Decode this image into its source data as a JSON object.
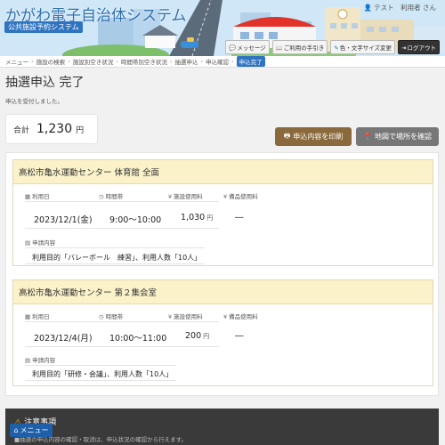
{
  "header": {
    "app_title": "かがわ電子自治体システム",
    "app_subtitle": "公共施設予約システム",
    "user_name": "テスト　利用者 さん",
    "buttons": {
      "message": "メッセージ",
      "guide": "ご利用の手引き",
      "font": "色・文字サイズ変更",
      "logout": "ログアウト"
    }
  },
  "breadcrumb": [
    "メニュー",
    "施設の検索",
    "施設別空き状況",
    "時間帯別空き状況",
    "抽選申込",
    "申込確認",
    "申込完了"
  ],
  "page": {
    "title": "抽選申込 完了",
    "message": "申込を受付しました。"
  },
  "total": {
    "label": "合計",
    "value": "1,230",
    "unit": "円"
  },
  "actions": {
    "print": "申込内容を印刷",
    "map": "地図で場所を確認"
  },
  "labels": {
    "date": "利用日",
    "time": "時間帯",
    "fee": "施設使用料",
    "equipment": "備品使用料",
    "content": "申請内容",
    "unit": "円"
  },
  "reservations": [
    {
      "facility": "高松市亀水運動センター 体育館 全面",
      "date": "2023/12/1(金)",
      "time": "9:00～10:00",
      "fee": "1,030",
      "equipment": "―",
      "content": "利用目的「バレーボール　練習」、利用人数「10人」"
    },
    {
      "facility": "高松市亀水運動センター 第２集会室",
      "date": "2023/12/4(月)",
      "time": "10:00～11:00",
      "fee": "200",
      "equipment": "―",
      "content": "利用目的「研修・会議」、利用人数「10人」"
    }
  ],
  "notice": {
    "title": "注意事項",
    "text": "■抽選の申込内容の確認・取消は、申込状況の確認から行えます。"
  },
  "menu_button": "メニュー",
  "colors": {
    "accent": "#2f74c0",
    "print_button": "#8a6a3c",
    "map_button": "#777777",
    "card_header": "#fbf2c9",
    "notice_bg": "#3a3a3a"
  }
}
